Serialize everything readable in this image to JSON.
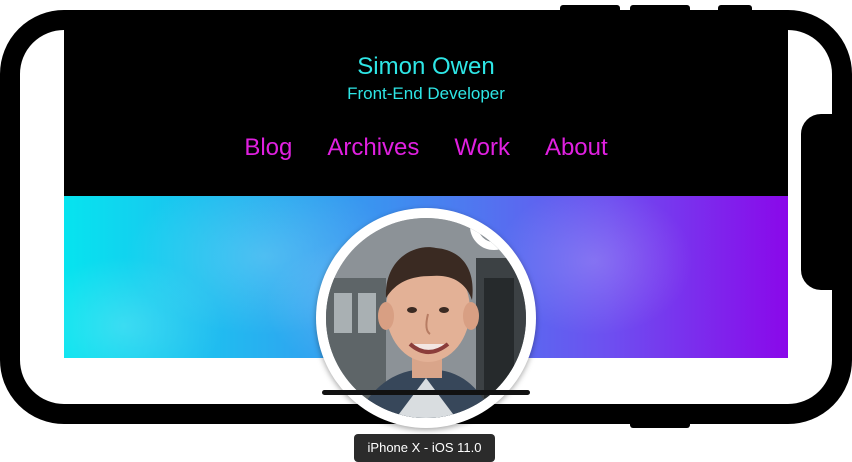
{
  "site": {
    "title": "Simon Owen",
    "subtitle": "Front-End Developer"
  },
  "nav": {
    "items": [
      {
        "label": "Blog"
      },
      {
        "label": "Archives"
      },
      {
        "label": "Work"
      },
      {
        "label": "About"
      }
    ]
  },
  "device": {
    "label": "iPhone X - iOS 11.0"
  },
  "colors": {
    "header_bg": "#000000",
    "title_color": "#2ee6e6",
    "nav_color": "#e020e0",
    "hero_gradient_start": "#06e4ef",
    "hero_gradient_end": "#8a08ea"
  }
}
